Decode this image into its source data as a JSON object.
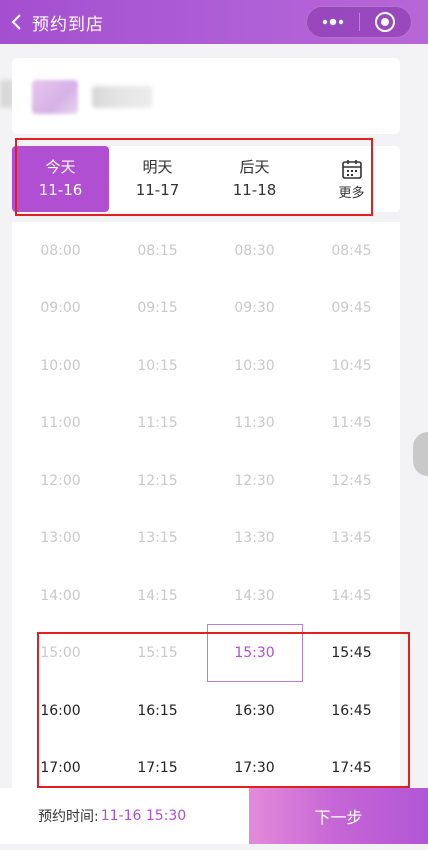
{
  "header": {
    "title": "预约到店",
    "menu_icon": "more-dots-icon",
    "close_icon": "target-close-icon"
  },
  "date_tabs": [
    {
      "label": "今天",
      "date": "11-16",
      "active": true
    },
    {
      "label": "明天",
      "date": "11-17",
      "active": false
    },
    {
      "label": "后天",
      "date": "11-18",
      "active": false
    }
  ],
  "more": {
    "label": "更多",
    "icon": "calendar-icon"
  },
  "time_slots": [
    [
      "08:00",
      "08:15",
      "08:30",
      "08:45"
    ],
    [
      "09:00",
      "09:15",
      "09:30",
      "09:45"
    ],
    [
      "10:00",
      "10:15",
      "10:30",
      "10:45"
    ],
    [
      "11:00",
      "11:15",
      "11:30",
      "11:45"
    ],
    [
      "12:00",
      "12:15",
      "12:30",
      "12:45"
    ],
    [
      "13:00",
      "13:15",
      "13:30",
      "13:45"
    ],
    [
      "14:00",
      "14:15",
      "14:30",
      "14:45"
    ],
    [
      "15:00",
      "15:15",
      "15:30",
      "15:45"
    ],
    [
      "16:00",
      "16:15",
      "16:30",
      "16:45"
    ],
    [
      "17:00",
      "17:15",
      "17:30",
      "17:45"
    ]
  ],
  "available_from": "15:45",
  "selected_time": "15:30",
  "footer": {
    "label": "预约时间:",
    "value": "11-16 15:30",
    "next_button": "下一步"
  },
  "colors": {
    "accent": "#b04fd2",
    "disabled": "#c9c9c9",
    "annotation": "#e02020"
  }
}
